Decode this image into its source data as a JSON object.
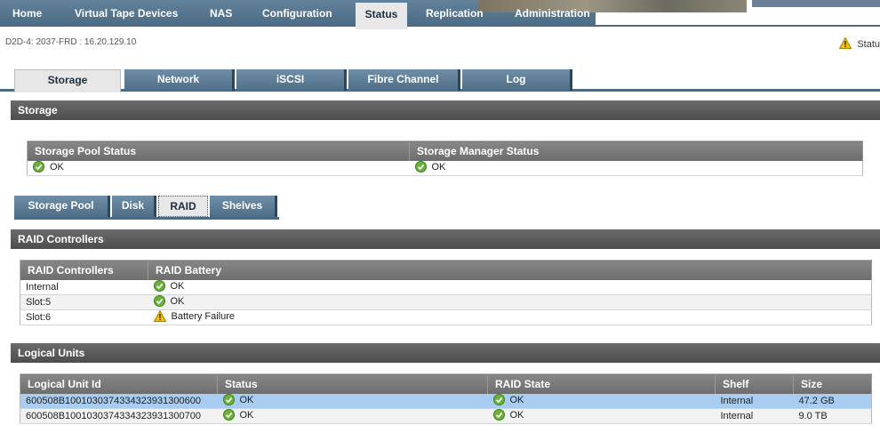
{
  "nav": {
    "items": [
      "Home",
      "Virtual Tape Devices",
      "NAS",
      "Configuration",
      "Status",
      "Replication",
      "Administration"
    ],
    "active": "Status"
  },
  "subheader": "D2D-4: 2037-FRD : 16.20.129.10",
  "status_label": "Statu",
  "main_tabs": [
    "Storage",
    "Network",
    "iSCSI",
    "Fibre Channel",
    "Log"
  ],
  "storage": {
    "title": "Storage",
    "headers": [
      "Storage Pool Status",
      "Storage Manager Status"
    ],
    "values": [
      "OK",
      "OK"
    ]
  },
  "sub_tabs": [
    "Storage Pool",
    "Disk",
    "RAID",
    "Shelves"
  ],
  "raid": {
    "title": "RAID Controllers",
    "headers": [
      "RAID Controllers",
      "RAID Battery"
    ],
    "rows": [
      {
        "name": "Internal",
        "status": "OK",
        "icon": "ok-icon"
      },
      {
        "name": "Slot:5",
        "status": "OK",
        "icon": "ok-icon"
      },
      {
        "name": "Slot:6",
        "status": "Battery Failure",
        "icon": "warning-icon"
      }
    ]
  },
  "units": {
    "title": "Logical Units",
    "headers": [
      "Logical Unit Id",
      "Status",
      "RAID State",
      "Shelf",
      "Size"
    ],
    "rows": [
      {
        "id": "600508B1001030374334323931300600",
        "status": "OK",
        "raid": "OK",
        "shelf": "Internal",
        "size": "47.2 GB"
      },
      {
        "id": "600508B1001030374334323931300700",
        "status": "OK",
        "raid": "OK",
        "shelf": "Internal",
        "size": "9.0 TB"
      }
    ]
  },
  "colors": {
    "nav": "#4b6a83",
    "section": "#555555",
    "selected_row": "#a9cdf0",
    "ok": "#6ab23a",
    "warning": "#f2c200"
  }
}
